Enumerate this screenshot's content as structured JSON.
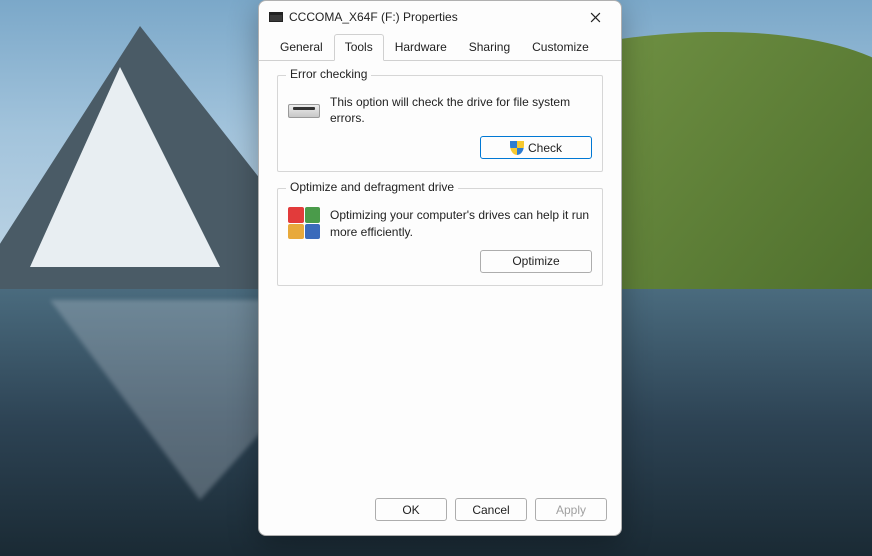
{
  "window": {
    "title": "CCCOMA_X64F (F:) Properties"
  },
  "tabs": {
    "general": "General",
    "tools": "Tools",
    "hardware": "Hardware",
    "sharing": "Sharing",
    "customize": "Customize",
    "active": "tools"
  },
  "error_checking": {
    "title": "Error checking",
    "description": "This option will check the drive for file system errors.",
    "button": "Check"
  },
  "optimize": {
    "title": "Optimize and defragment drive",
    "description": "Optimizing your computer's drives can help it run more efficiently.",
    "button": "Optimize"
  },
  "footer": {
    "ok": "OK",
    "cancel": "Cancel",
    "apply": "Apply"
  }
}
